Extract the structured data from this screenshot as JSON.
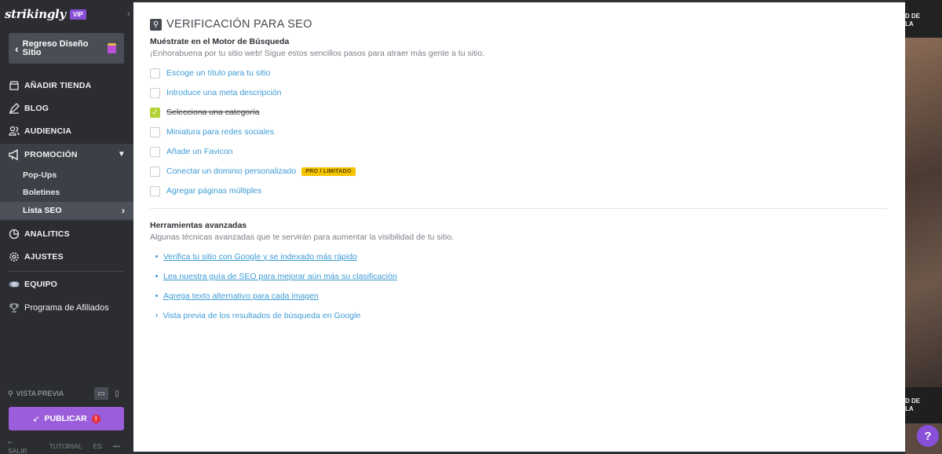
{
  "brand": {
    "logo": "strikingly",
    "badge": "VIP"
  },
  "sidebar": {
    "collapse_icon": "chevron-left-icon",
    "back_label": "Regreso Diseño Sitio",
    "nav": [
      {
        "label": "AÑADIR TIENDA",
        "icon": "store-icon"
      },
      {
        "label": "BLOG",
        "icon": "pen-icon"
      },
      {
        "label": "AUDIENCIA",
        "icon": "people-icon"
      },
      {
        "label": "PROMOCIÓN",
        "icon": "megaphone-icon"
      },
      {
        "label": "ANALITICS",
        "icon": "pie-chart-icon"
      },
      {
        "label": "AJUSTES",
        "icon": "gear-icon"
      },
      {
        "label": "EQUIPO",
        "icon": "team-icon"
      },
      {
        "label": "Programa de Afiliados",
        "icon": "trophy-icon"
      }
    ],
    "sub_items": [
      "Pop-Ups",
      "Boletines",
      "Lista SEO"
    ],
    "preview_label": "VISTA PREVIA",
    "publish_label": "PUBLICAR",
    "publish_alert": "!",
    "footer": {
      "exit": "SALIR",
      "tutorial": "TUTORIAL",
      "lang": "ES",
      "more": "•••"
    }
  },
  "main": {
    "title": "VERIFICACIÓN PARA SEO",
    "search_heading": "Muéstrate en el Motor de Búsqueda",
    "search_sub": "¡Enhorabuena por tu sitio web! Sigue estos sencillos pasos para atraer más gente a tu sitio.",
    "checklist": [
      {
        "label": "Escoge un título para tu sitio",
        "checked": false
      },
      {
        "label": "Introduce una meta descripción",
        "checked": false
      },
      {
        "label": "Selecciona una categoría",
        "checked": true
      },
      {
        "label": "Miniatura para redes sociales",
        "checked": false
      },
      {
        "label": "Añade un Favicon",
        "checked": false
      },
      {
        "label": "Conectar un dominio personalizado",
        "checked": false,
        "badge": "PRO / LIMITADO"
      },
      {
        "label": "Agregar páginas múltiples",
        "checked": false
      }
    ],
    "advanced_heading": "Herramientas avanzadas",
    "advanced_sub": "Algunas técnicas avanzadas que te servirán para aumentar la visibilidad de tu sitio.",
    "links": [
      "Verifica tu sitio con Google y se indexado más rápido",
      "Lea nuestra guía de SEO para mejorar aún más su clasificación",
      "Agrega texto alternativo para cada imagen"
    ],
    "google_preview": "Vista previa de los resultados de búsqueda en Google"
  },
  "right_strip": {
    "top_text": "D DE\nLA",
    "mid_text": "D DE\nLA",
    "help": "?"
  },
  "colors": {
    "accent": "#9b5ddb",
    "link": "#3d9bd6",
    "check": "#b3d235",
    "badge": "#f5c400"
  }
}
